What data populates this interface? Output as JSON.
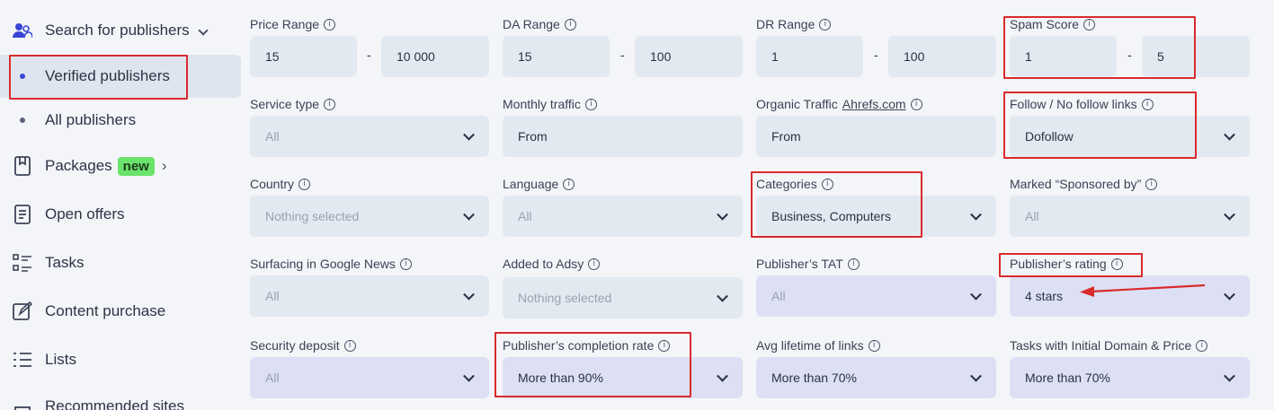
{
  "sidebar": {
    "items": [
      {
        "label": "Search for publishers",
        "icon": "users-icon"
      },
      {
        "label": "Verified publishers",
        "icon": "dot-icon"
      },
      {
        "label": "All publishers",
        "icon": "dot-icon"
      },
      {
        "label": "Packages",
        "badge": "new",
        "icon": "bookmark-icon"
      },
      {
        "label": "Open offers",
        "icon": "document-icon"
      },
      {
        "label": "Tasks",
        "icon": "tasks-icon"
      },
      {
        "label": "Content purchase",
        "icon": "edit-icon"
      },
      {
        "label": "Lists",
        "icon": "list-icon"
      },
      {
        "label": "Recommended sites",
        "icon": "recommended-icon"
      }
    ]
  },
  "filters": {
    "price_range": {
      "label": "Price Range",
      "from": "15",
      "to": "10 000"
    },
    "da_range": {
      "label": "DA Range",
      "from": "15",
      "to": "100"
    },
    "dr_range": {
      "label": "DR Range",
      "from": "1",
      "to": "100"
    },
    "spam_score": {
      "label": "Spam Score",
      "from": "1",
      "to": "5"
    },
    "service_type": {
      "label": "Service type",
      "value": "All"
    },
    "monthly_traffic": {
      "label": "Monthly traffic",
      "placeholder": "From"
    },
    "organic_traffic": {
      "label": "Organic Traffic",
      "link": "Ahrefs.com",
      "placeholder": "From"
    },
    "follow_links": {
      "label": "Follow / No follow links",
      "value": "Dofollow"
    },
    "country": {
      "label": "Country",
      "value": "Nothing selected"
    },
    "language": {
      "label": "Language",
      "value": "All"
    },
    "categories": {
      "label": "Categories",
      "value": "Business, Computers"
    },
    "sponsored": {
      "label": "Marked “Sponsored by”",
      "value": "All"
    },
    "google_news": {
      "label": "Surfacing in Google News",
      "value": "All"
    },
    "added_to_adsy": {
      "label": "Added to Adsy",
      "value": "Nothing selected"
    },
    "publisher_tat": {
      "label": "Publisher’s TAT",
      "value": "All"
    },
    "publisher_rating": {
      "label": "Publisher’s rating",
      "value": "4 stars"
    },
    "security_deposit": {
      "label": "Security deposit",
      "value": "All"
    },
    "completion_rate": {
      "label": "Publisher’s completion rate",
      "value": "More than 90%"
    },
    "avg_lifetime": {
      "label": "Avg lifetime of links",
      "value": "More than 70%"
    },
    "initial_domain_price": {
      "label": "Tasks with Initial Domain & Price",
      "value": "More than 70%"
    }
  },
  "range_separator": "-",
  "info_glyph": "i",
  "colors": {
    "highlight": "#d92b2b",
    "accent": "#3a45d6",
    "new_badge": "#6be36b"
  }
}
